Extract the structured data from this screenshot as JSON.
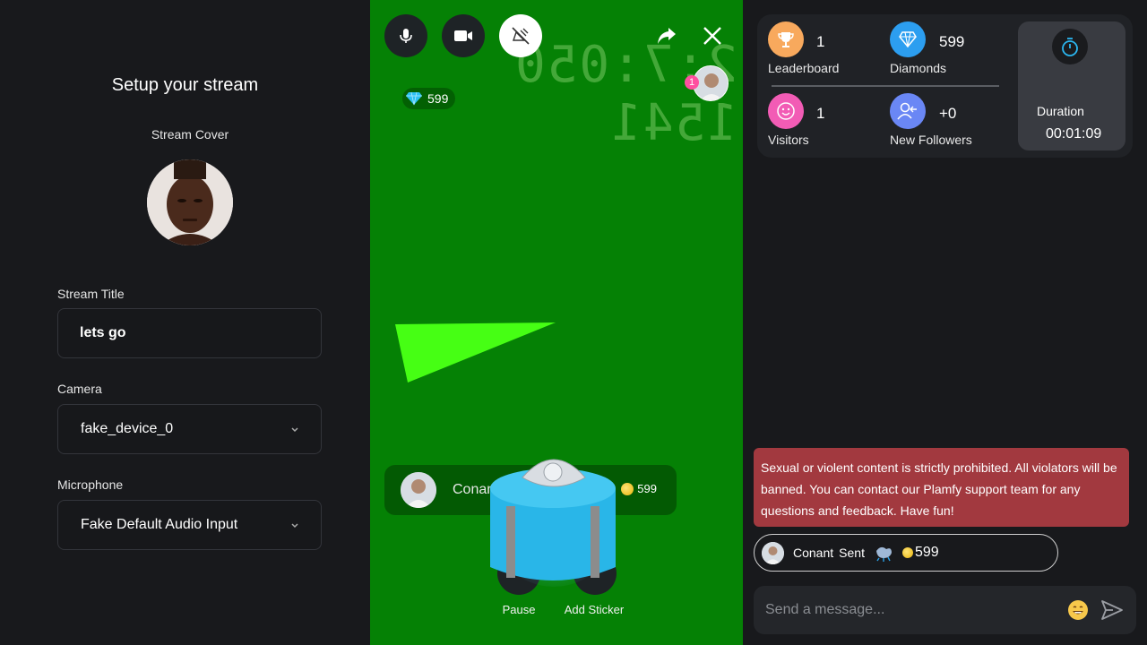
{
  "setup": {
    "title": "Setup your stream",
    "cover_label": "Stream Cover",
    "title_label": "Stream Title",
    "title_value": "lets go",
    "camera_label": "Camera",
    "camera_value": "fake_device_0",
    "mic_label": "Microphone",
    "mic_value": "Fake Default Audio Input"
  },
  "stream": {
    "ghost_text": "2:7:050 1541",
    "viewer_count": "1",
    "diamonds": "599",
    "gift_sender": "Conant",
    "gift_amount": "599",
    "pause_label": "Pause",
    "sticker_label": "Add Sticker"
  },
  "stats": {
    "leaderboard_value": "1",
    "leaderboard_label": "Leaderboard",
    "diamonds_value": "599",
    "diamonds_label": "Diamonds",
    "visitors_value": "1",
    "visitors_label": "Visitors",
    "followers_value": "+0",
    "followers_label": "New Followers",
    "duration_label": "Duration",
    "duration_value": "00:01:09"
  },
  "chat": {
    "warning": "Sexual or violent content is strictly prohibited. All violators will be banned. You can contact our Plamfy support team for any questions and feedback. Have fun!",
    "gift_name": "Conant",
    "gift_sent": "Sent",
    "gift_amount": "599",
    "placeholder": "Send a message..."
  },
  "colors": {
    "stream_bg": "#058105",
    "warning_bg": "#a2393f",
    "leaderboard_icon": "#f8a95d",
    "diamonds_icon": "#2c9ef0",
    "visitors_icon": "#f25cb5",
    "followers_icon": "#6a87f5"
  }
}
